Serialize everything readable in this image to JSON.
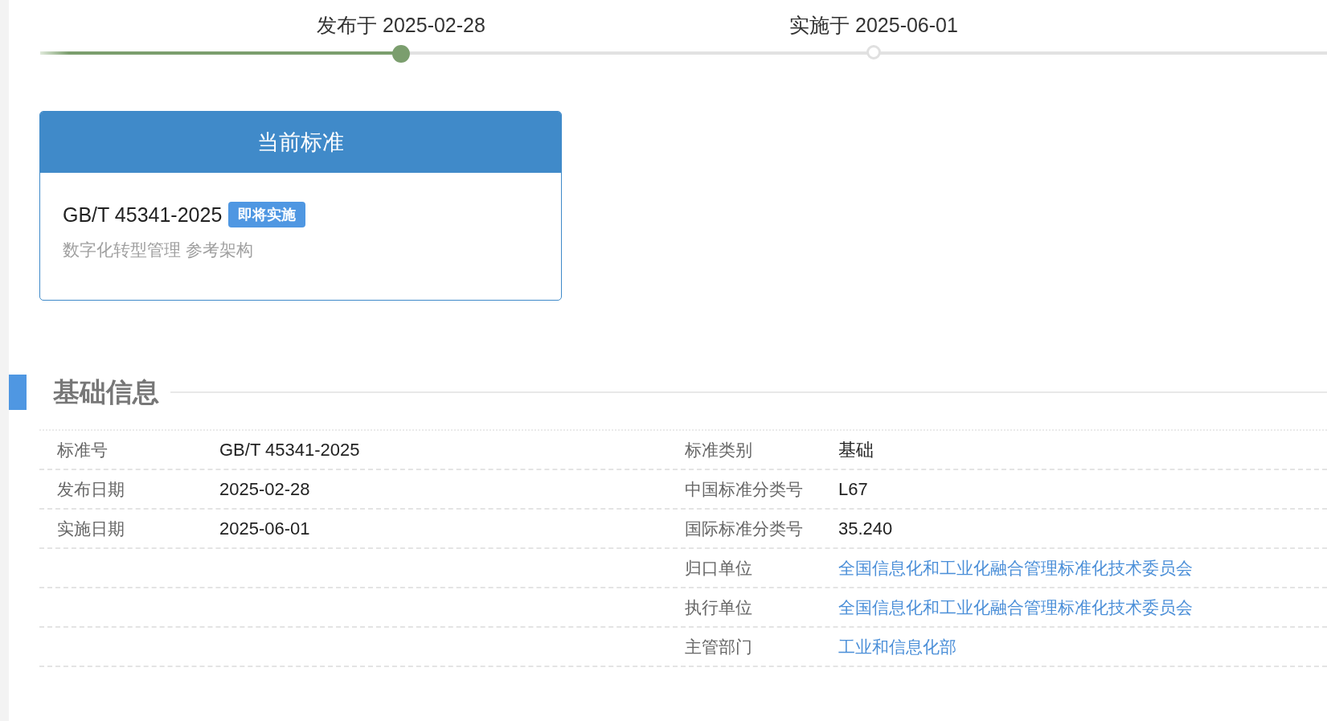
{
  "timeline": {
    "level": 0.28,
    "milestones": [
      {
        "label": "发布于 2025-02-28",
        "reached": true
      },
      {
        "label": "实施于 2025-06-01",
        "reached": false
      }
    ]
  },
  "current_standard": {
    "title": "当前标准",
    "code": "GB/T 45341-2025",
    "badge": "即将实施",
    "name": "数字化转型管理 参考架构"
  },
  "basic_info": {
    "title": "基础信息",
    "rows": [
      {
        "left": {
          "label": "标准号",
          "value": "GB/T 45341-2025"
        },
        "right": {
          "label": "标准类别",
          "value": "基础",
          "kind": "text"
        }
      },
      {
        "left": {
          "label": "发布日期",
          "value": "2025-02-28"
        },
        "right": {
          "label": "中国标准分类号",
          "value": "L67",
          "kind": "text"
        }
      },
      {
        "left": {
          "label": "实施日期",
          "value": "2025-06-01"
        },
        "right": {
          "label": "国际标准分类号",
          "value": "35.240",
          "kind": "text"
        }
      },
      {
        "right": {
          "label": "归口单位",
          "value": "全国信息化和工业化融合管理标准化技术委员会",
          "kind": "link"
        }
      },
      {
        "right": {
          "label": "执行单位",
          "value": "全国信息化和工业化融合管理标准化技术委员会",
          "kind": "link"
        }
      },
      {
        "right": {
          "label": "主管部门",
          "value": "工业和信息化部",
          "kind": "link"
        }
      }
    ]
  }
}
